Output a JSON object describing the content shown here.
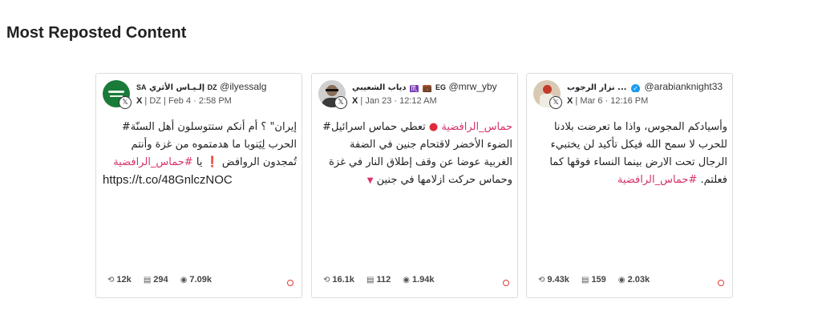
{
  "section_title": "Most Reposted Content",
  "posts": [
    {
      "display_name": "إلـيـاس الأثري",
      "country_flag": "SA",
      "country_code": "DZ",
      "handle": "@ilyessalg",
      "platform": "X",
      "meta": "DZ | Feb 4 · 2:58 PM",
      "text_1": "إيران\" ؟ أم أنكم ستتوسلون أهل السنّة#",
      "text_2": "الحرب لِيَنوبا ما هدمتموه من غزة وأنتم",
      "text_3": "تُمجدون الروافض",
      "text_3_excl": "❗",
      "text_3_b": "يا",
      "hashtag": "#حماس_الرافضية",
      "link": "https://t.co/48GnlczNOC",
      "stats": {
        "reposts": "12k",
        "replies": "294",
        "views": "7.09k"
      }
    },
    {
      "display_name": "دياب الشعيبي",
      "zodiac": "♏",
      "briefcase": "💼",
      "country_code": "EG",
      "handle": "@mrw_yby",
      "platform": "X",
      "meta": "Jan 23 · 12:12 AM",
      "hashtag": "حماس_الرافضية",
      "text_1": "تعطي حماس اسرائيل#",
      "text_2": "الضوء الأخضر لاقتحام جنين في الضفة",
      "text_3": "الغربية عوضا عن وقف إطلاق النار في غزة",
      "text_4": "وحماس حركت ازلامها في جنين",
      "stats": {
        "reposts": "16.1k",
        "replies": "112",
        "views": "1.94k"
      }
    },
    {
      "display_name": "نزار الرجوب ...",
      "handle": "@arabianknight33",
      "platform": "X",
      "meta": "Mar 6 · 12:16 PM",
      "text_1": "وأسيادكم المجوس، واذا ما تعرضت بلادنا",
      "text_2": "للحرب لا سمح الله فيكل تأكيد لن يختبيء",
      "text_3": "الرجال تحت الارض بينما النساء فوقها كما",
      "text_4": "فعلتم.",
      "hashtag": "#حماس_الرافضية",
      "stats": {
        "reposts": "9.43k",
        "replies": "159",
        "views": "2.03k"
      }
    }
  ],
  "icons": {
    "repost": "repost-icon",
    "reply": "reply-icon",
    "views": "eye-icon",
    "platform": "x-logo-icon",
    "more": "more-icon"
  },
  "colors": {
    "hashtag": "#d6336c",
    "more": "#e03a3a",
    "verified": "#1d9bf0"
  }
}
